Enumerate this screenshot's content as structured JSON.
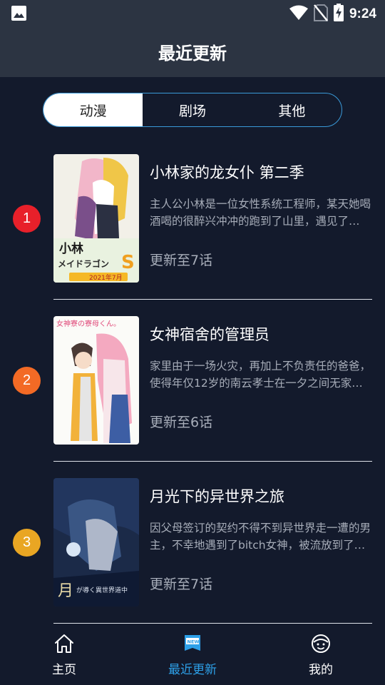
{
  "status_bar": {
    "time": "9:24"
  },
  "header": {
    "title": "最近更新"
  },
  "tabs": [
    {
      "label": "动漫",
      "active": true
    },
    {
      "label": "剧场",
      "active": false
    },
    {
      "label": "其他",
      "active": false
    }
  ],
  "items": [
    {
      "rank": "1",
      "rank_color": "#e8202a",
      "title": "小林家的龙女仆 第二季",
      "desc": "主人公小林是一位女性系统工程师，某天她喝酒喝的很醉兴冲冲的跑到了山里，遇见了一只龙",
      "episode": "更新至7话",
      "cover_text": "小林さんちのメイドラゴンS",
      "cover_date": "2021年7月"
    },
    {
      "rank": "2",
      "rank_color": "#f36a25",
      "title": "女神宿舍的管理员",
      "desc": "家里由于一场火灾，再加上不负责任的爸爸，使得年仅12岁的南云孝士在一夕之间无家可归",
      "episode": "更新至6话",
      "cover_text": "女神寮の寮母くん。"
    },
    {
      "rank": "3",
      "rank_color": "#e9a623",
      "title": "月光下的异世界之旅",
      "desc": "因父母签订的契约不得不到异世界走一遭的男主，不幸地遇到了bitch女神，被流放到了世界尽头",
      "episode": "更新至7话",
      "cover_text": "月が導く異世界道中"
    }
  ],
  "bottom_nav": [
    {
      "label": "主页",
      "icon": "home-icon",
      "active": false
    },
    {
      "label": "最近更新",
      "icon": "new-badge-icon",
      "active": true
    },
    {
      "label": "我的",
      "icon": "face-icon",
      "active": false
    }
  ],
  "colors": {
    "background": "#131a2c",
    "bar": "#2c3442",
    "accent": "#2da0e8",
    "segment_border": "#3a9ad9"
  }
}
